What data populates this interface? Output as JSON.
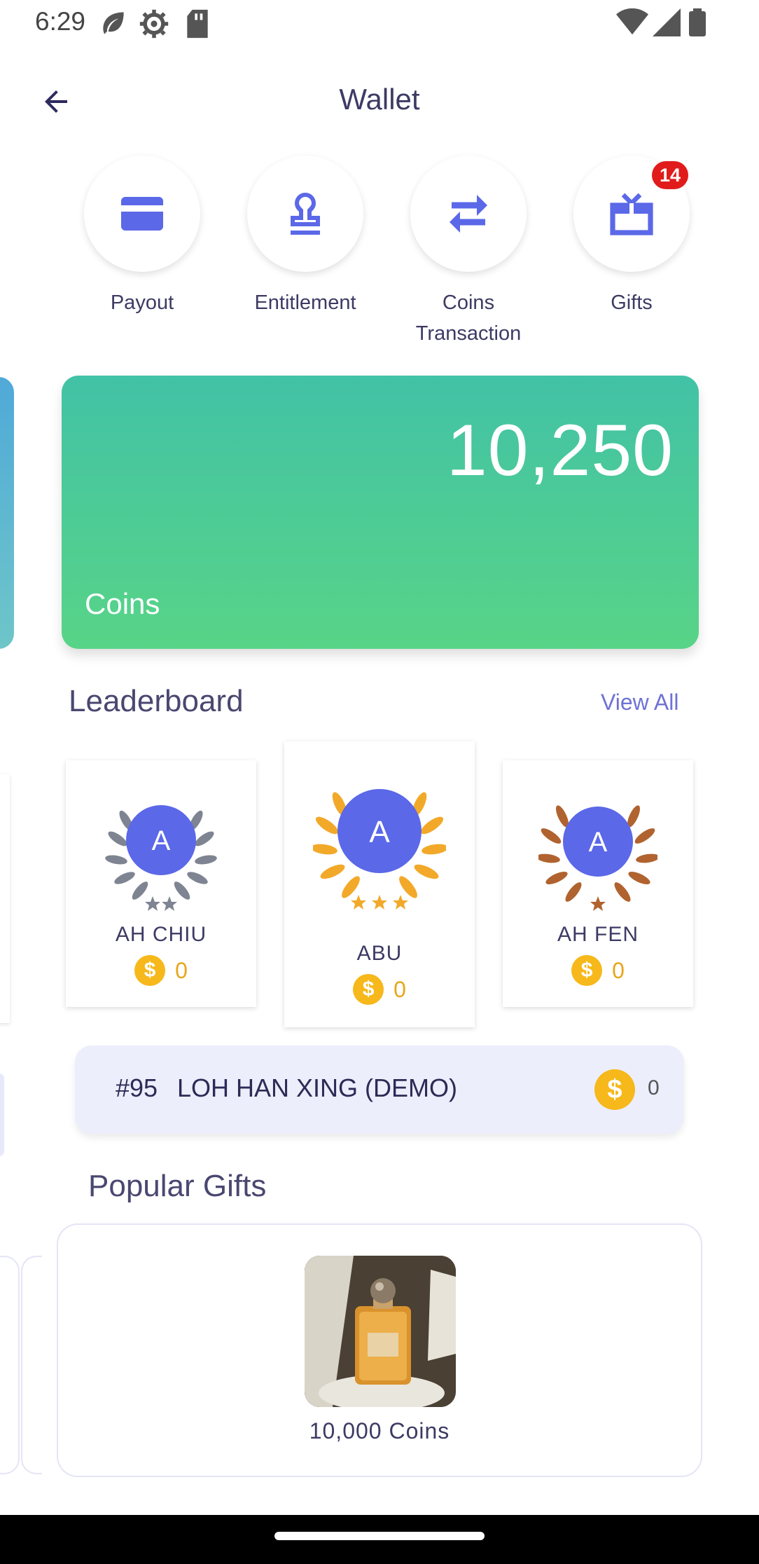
{
  "status": {
    "time": "6:29",
    "left_icons": [
      "leaf-icon",
      "gear-icon",
      "sd-card-icon"
    ],
    "right_icons": [
      "wifi-icon",
      "signal-icon",
      "battery-icon"
    ]
  },
  "header": {
    "title": "Wallet",
    "back_icon": "arrow-left-icon"
  },
  "actions": [
    {
      "label": "Payout",
      "icon": "credit-card-icon"
    },
    {
      "label": "Entitlement",
      "icon": "stamp-icon"
    },
    {
      "label": "Coins\nTransaction",
      "icon": "swap-arrows-icon"
    },
    {
      "label": "Gifts",
      "icon": "gift-box-icon",
      "badge": "14"
    }
  ],
  "coin_card": {
    "value": "10,250",
    "label": "Coins"
  },
  "leaderboard": {
    "title": "Leaderboard",
    "view_all": "View All",
    "entries": [
      {
        "rank_style": "silver",
        "initial": "A",
        "name": "AH CHIU",
        "coins": "0",
        "stars": 2
      },
      {
        "rank_style": "gold",
        "initial": "A",
        "name": "ABU",
        "coins": "0",
        "stars": 3
      },
      {
        "rank_style": "bronze",
        "initial": "A",
        "name": "AH FEN",
        "coins": "0",
        "stars": 1
      }
    ]
  },
  "my_rank": {
    "rank": "#95",
    "name": "LOH HAN XING (DEMO)",
    "coins": "0"
  },
  "popular_gifts": {
    "title": "Popular Gifts",
    "items": [
      {
        "price": "10,000 Coins",
        "image": "perfume-bottle-image"
      }
    ]
  },
  "colors": {
    "accent": "#5b68e8",
    "title_text": "#3d3a64",
    "coin_card_top": "#42c2a6",
    "coin_card_bottom": "#58d487",
    "badge": "#e11b1b",
    "coin_gold": "#f6b81a",
    "gold": "#f2a92a",
    "silver": "#7e8491",
    "bronze": "#b0632f"
  }
}
